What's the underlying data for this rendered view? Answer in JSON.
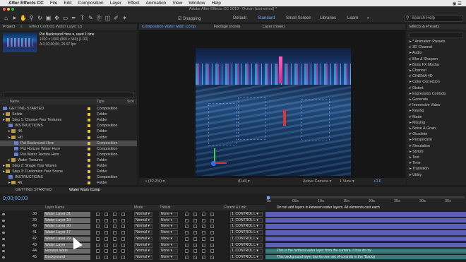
{
  "menubar": {
    "app_name": "After Effects CC",
    "items": [
      "File",
      "Edit",
      "Composition",
      "Layer",
      "Effect",
      "Animation",
      "View",
      "Window",
      "Help"
    ]
  },
  "toolbar": {
    "window_title": "Adobe After Effects CC 2019 - Ocean (converted) *",
    "snapping_label": "Snapping",
    "workspaces": [
      "Default",
      "Standard",
      "Small Screen",
      "Libraries",
      "Learn"
    ],
    "active_workspace": "Standard",
    "search_placeholder": "Search Help"
  },
  "project": {
    "panel_tabs": [
      "Project",
      "Effect Controls Water Layer 15"
    ],
    "selected_item": {
      "name": "Put Backround Here",
      "usage": ", used 1 time",
      "size": "1920 x 1080 (960 x 540) (1.00)",
      "duration": "Δ 0;10;00;00, 29.97 fps"
    },
    "columns": {
      "name": "Name",
      "type": "Type",
      "size": "Size"
    },
    "items": [
      {
        "name": "GETTING STARTED",
        "type": "Composition",
        "kind": "comp",
        "indent": 0,
        "selected": false
      },
      {
        "name": "Solids",
        "type": "Folder",
        "kind": "folder",
        "indent": 0,
        "selected": false
      },
      {
        "name": "Step 1: Choose Your Textures",
        "type": "Folder",
        "kind": "folder",
        "indent": 0,
        "selected": false
      },
      {
        "name": "INSTRUCTIONS",
        "type": "Composition",
        "kind": "comp",
        "indent": 1,
        "selected": false
      },
      {
        "name": "4K",
        "type": "Folder",
        "kind": "folder",
        "indent": 1,
        "selected": false
      },
      {
        "name": "HD",
        "type": "Folder",
        "kind": "folder",
        "indent": 1,
        "selected": false
      },
      {
        "name": "Put Backround Here",
        "type": "Composition",
        "kind": "comp",
        "indent": 2,
        "selected": true
      },
      {
        "name": "Put Horizon Water Here",
        "type": "Composition",
        "kind": "comp",
        "indent": 2,
        "selected": false
      },
      {
        "name": "Put Water Texture Here",
        "type": "Composition",
        "kind": "comp",
        "indent": 2,
        "selected": false
      },
      {
        "name": "Water Textures",
        "type": "Folder",
        "kind": "folder",
        "indent": 1,
        "selected": false
      },
      {
        "name": "Step 2: Shape Your Waves",
        "type": "Folder",
        "kind": "folder",
        "indent": 0,
        "selected": false
      },
      {
        "name": "Step 3: Customize Your Scene",
        "type": "Folder",
        "kind": "folder",
        "indent": 0,
        "selected": false
      },
      {
        "name": "INSTRUCTIONS",
        "type": "Composition",
        "kind": "comp",
        "indent": 1,
        "selected": false
      },
      {
        "name": "4K",
        "type": "Folder",
        "kind": "folder",
        "indent": 1,
        "selected": false
      },
      {
        "name": "HD",
        "type": "Folder",
        "kind": "folder",
        "indent": 1,
        "selected": false
      },
      {
        "name": "Extra Effects",
        "type": "Folder",
        "kind": "folder",
        "indent": 2,
        "selected": false
      }
    ]
  },
  "composition": {
    "tabs": [
      "Composition Water Main Comp",
      "Footage (none)",
      "Layer (none)"
    ],
    "zoom": "(82.2%)",
    "resolution": "(Full)",
    "camera": "Active Camera",
    "views": "1 View",
    "exposure": "+0.0"
  },
  "effects_panel": {
    "title": "Effects & Presets",
    "categories": [
      "* Animation Presets",
      "3D Channel",
      "Audio",
      "Blur & Sharpen",
      "Boris FX Mocha",
      "Channel",
      "CINEMA 4D",
      "Color Correction",
      "Distort",
      "Expression Controls",
      "Generate",
      "Immersive Video",
      "Keying",
      "Matte",
      "Missing",
      "Noise & Grain",
      "Obsolete",
      "Perspective",
      "Simulation",
      "Stylize",
      "Text",
      "Time",
      "Transition",
      "Utility"
    ]
  },
  "timeline": {
    "tabs": [
      "GETTING STARTED",
      "Water Main Comp"
    ],
    "timecode": "0;00;00;03",
    "columns": {
      "layer_name": "Layer Name",
      "mode": "Mode",
      "trkmat": "TrkMat",
      "parent": "Parent & Link"
    },
    "time_ticks": [
      "0s",
      "05s",
      "10s",
      "15s",
      "20s",
      "25s",
      "30s",
      "35s"
    ],
    "layers": [
      {
        "num": "38",
        "name": "Water Layer 31",
        "mode": "Normal",
        "trkmat": "None",
        "parent": "1. CONTROL L"
      },
      {
        "num": "39",
        "name": "Water Layer 18",
        "mode": "Normal",
        "trkmat": "None",
        "parent": "1. CONTROL L"
      },
      {
        "num": "40",
        "name": "Water Layer 30",
        "mode": "Normal",
        "trkmat": "None",
        "parent": "1. CONTROL L"
      },
      {
        "num": "41",
        "name": "Water Layer 17",
        "mode": "Normal",
        "trkmat": "None",
        "parent": "1. CONTROL L"
      },
      {
        "num": "42",
        "name": "Water Layer 29",
        "mode": "Normal",
        "trkmat": "None",
        "parent": "1. CONTROL L"
      },
      {
        "num": "43",
        "name": "Water Layer",
        "mode": "Normal",
        "trkmat": "None",
        "parent": "1. CONTROL L"
      },
      {
        "num": "44",
        "name": "Horizon Wate",
        "mode": "Normal",
        "trkmat": "None",
        "parent": "1. CONTROL L"
      },
      {
        "num": "45",
        "name": "Background",
        "mode": "Normal",
        "trkmat": "None",
        "parent": "1. CONTROL L"
      }
    ],
    "track_notes": [
      "Do not add layers in between water layers. All elements cast each",
      "This is the farthest water layer from the camera. It has its ow",
      "This background layer has its own set of controls in the \"Backg"
    ]
  },
  "colors": {
    "accent": "#6aa6ff",
    "label_yellow": "#e2c846",
    "comp_icon": "#6a7ec8",
    "track_bar": "#5b5fb8",
    "track_bar_teal": "#3a7a7a"
  }
}
